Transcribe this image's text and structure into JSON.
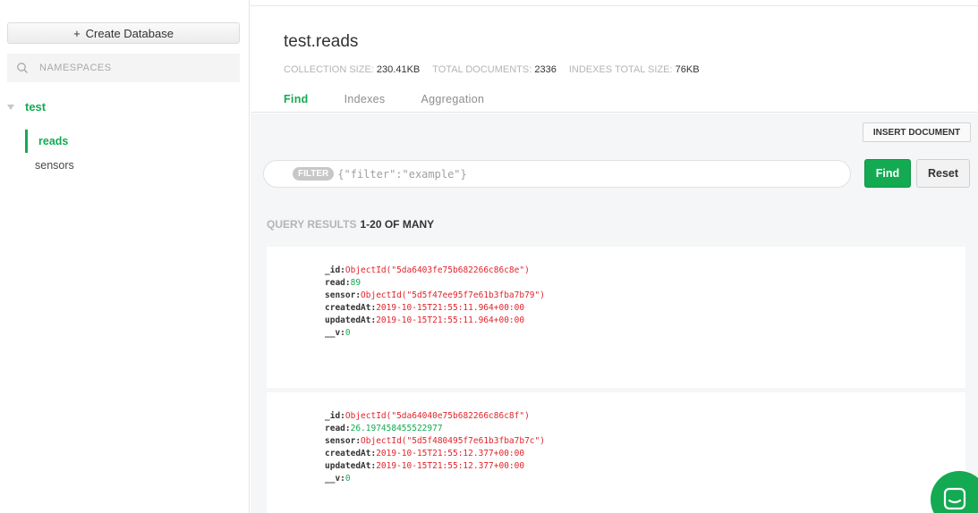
{
  "sidebar": {
    "create_label": "Create Database",
    "search_placeholder": "NAMESPACES",
    "database": "test",
    "collections": [
      "reads",
      "sensors"
    ]
  },
  "header": {
    "title": "test.reads",
    "stats": [
      {
        "label": "COLLECTION SIZE:",
        "value": "230.41KB"
      },
      {
        "label": "TOTAL DOCUMENTS:",
        "value": "2336"
      },
      {
        "label": "INDEXES TOTAL SIZE:",
        "value": "76KB"
      }
    ],
    "tabs": [
      "Find",
      "Indexes",
      "Aggregation"
    ]
  },
  "toolbar": {
    "insert_label": "INSERT DOCUMENT",
    "filter_badge": "FILTER",
    "filter_placeholder": "{\"filter\":\"example\"}",
    "find_label": "Find",
    "reset_label": "Reset"
  },
  "results": {
    "label": "QUERY RESULTS",
    "range": "1-20 OF MANY"
  },
  "documents": [
    {
      "fields": [
        {
          "key": "_id:",
          "value": "ObjectId(\"5da6403fe75b682266c86c8e\")"
        },
        {
          "key": "read:",
          "value": "89"
        },
        {
          "key": "sensor:",
          "value": "ObjectId(\"5d5f47ee95f7e61b3fba7b79\")"
        },
        {
          "key": "createdAt:",
          "value": "2019-10-15T21:55:11.964+00:00"
        },
        {
          "key": "updatedAt:",
          "value": "2019-10-15T21:55:11.964+00:00"
        },
        {
          "key": "__v:",
          "value": "0"
        }
      ]
    },
    {
      "fields": [
        {
          "key": "_id:",
          "value": "ObjectId(\"5da64040e75b682266c86c8f\")"
        },
        {
          "key": "read:",
          "value": "26.197458455522977"
        },
        {
          "key": "sensor:",
          "value": "ObjectId(\"5d5f480495f7e61b3fba7b7c\")"
        },
        {
          "key": "createdAt:",
          "value": "2019-10-15T21:55:12.377+00:00"
        },
        {
          "key": "updatedAt:",
          "value": "2019-10-15T21:55:12.377+00:00"
        },
        {
          "key": "__v:",
          "value": "0"
        }
      ]
    }
  ],
  "colors": {
    "accent": "#13aa52",
    "string_value": "#e0242a"
  }
}
